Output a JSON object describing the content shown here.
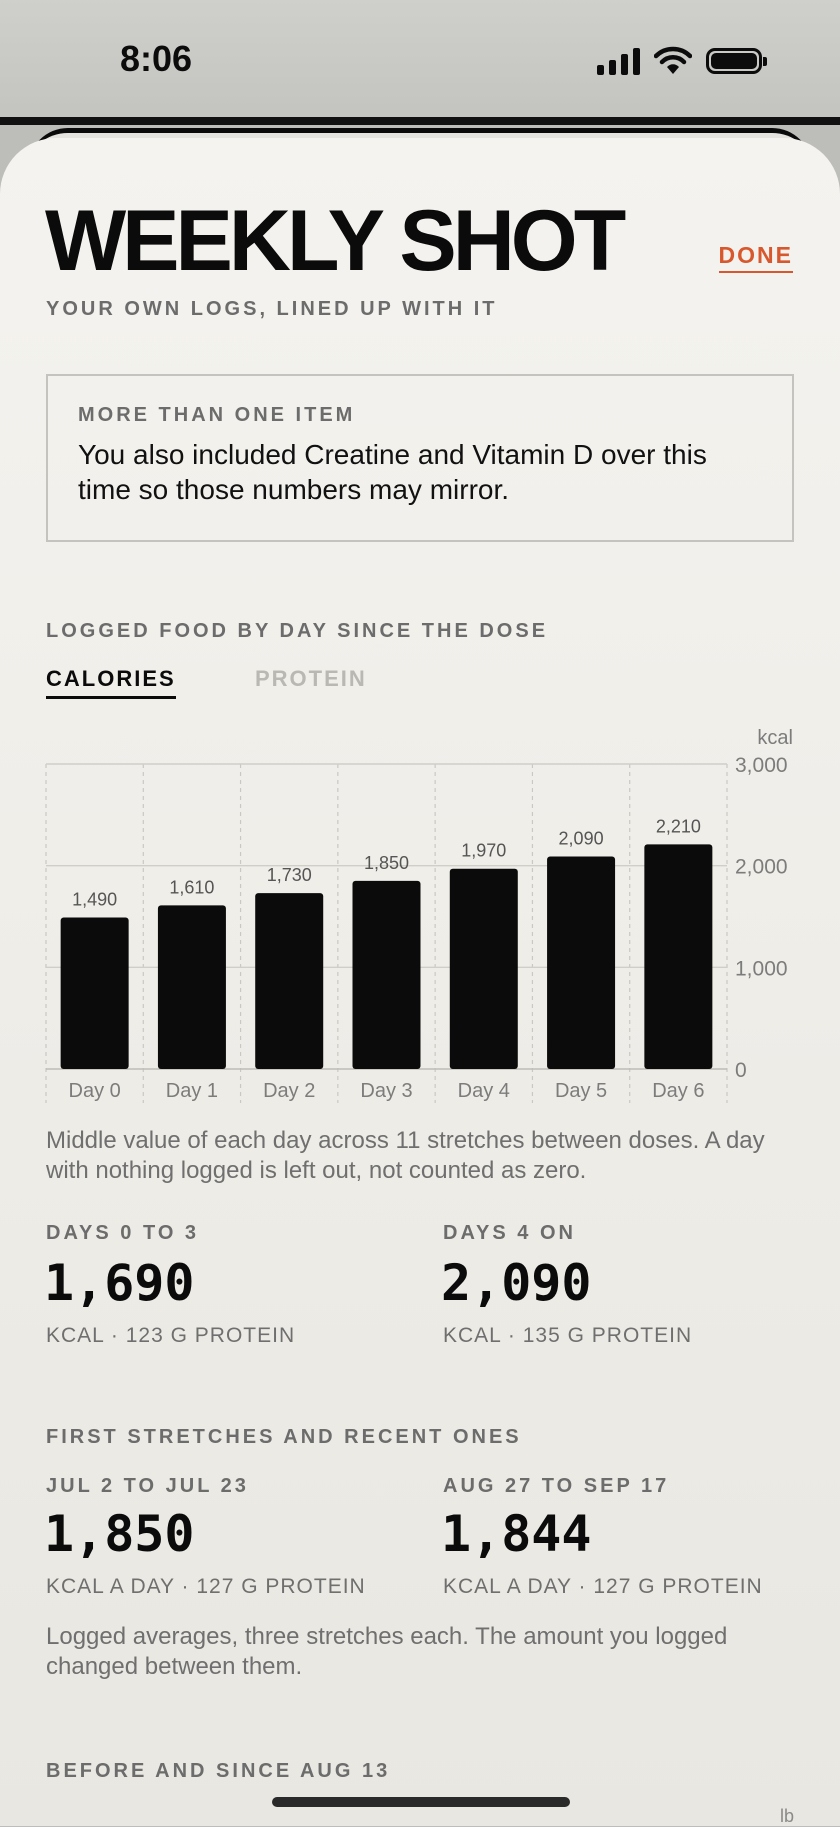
{
  "status_bar": {
    "time": "8:06"
  },
  "header": {
    "title": "WEEKLY SHOT",
    "done_label": "DONE",
    "subtitle": "YOUR OWN LOGS, LINED UP WITH IT"
  },
  "notice": {
    "heading": "MORE THAN ONE ITEM",
    "body": "You also included Creatine and Vitamin D over this time so those numbers may mirror."
  },
  "food_section": {
    "label": "LOGGED FOOD BY DAY SINCE THE DOSE",
    "tabs": [
      {
        "label": "CALORIES",
        "active": true
      },
      {
        "label": "PROTEIN",
        "active": false
      }
    ],
    "note": "Middle value of each day across 11 stretches between doses. A day with nothing logged is left out, not counted as zero."
  },
  "chart_data": {
    "type": "bar",
    "unit_label": "kcal",
    "categories": [
      "Day 0",
      "Day 1",
      "Day 2",
      "Day 3",
      "Day 4",
      "Day 5",
      "Day 6"
    ],
    "values": [
      1490,
      1610,
      1730,
      1850,
      1970,
      2090,
      2210
    ],
    "value_labels": [
      "1,490",
      "1,610",
      "1,730",
      "1,850",
      "1,970",
      "2,090",
      "2,210"
    ],
    "ylim": [
      0,
      3000
    ],
    "yticks": [
      0,
      1000,
      2000,
      3000
    ],
    "ytick_labels": [
      "0",
      "1,000",
      "2,000",
      "3,000"
    ],
    "grid": true,
    "bar_color": "#0b0b0b"
  },
  "summary": {
    "left": {
      "label": "DAYS 0 TO 3",
      "value": "1,690",
      "sub": "KCAL · 123 G PROTEIN"
    },
    "right": {
      "label": "DAYS 4 ON",
      "value": "2,090",
      "sub": "KCAL · 135 G PROTEIN"
    }
  },
  "stretches": {
    "label": "FIRST STRETCHES AND RECENT ONES",
    "left": {
      "label": "JUL 2 TO JUL 23",
      "value": "1,850",
      "sub": "KCAL A DAY · 127 G PROTEIN"
    },
    "right": {
      "label": "AUG 27 TO SEP 17",
      "value": "1,844",
      "sub": "KCAL A DAY · 127 G PROTEIN"
    },
    "note": "Logged averages, three stretches each. The amount you logged changed between them."
  },
  "before_since": {
    "label": "BEFORE AND SINCE AUG 13",
    "unit": "lb"
  },
  "colors": {
    "accent": "#d8582e",
    "ink": "#0b0b0b",
    "muted": "#6c6c6c"
  }
}
